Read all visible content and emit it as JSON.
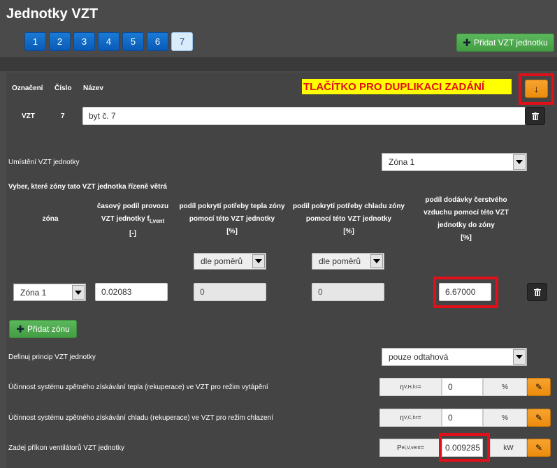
{
  "title": "Jednotky VZT",
  "pager": [
    "1",
    "2",
    "3",
    "4",
    "5",
    "6",
    "7"
  ],
  "add_unit_label": "Přidat VZT jednotku",
  "header": {
    "col_oznaceni": "Označení",
    "col_cislo": "Číslo",
    "col_nazev": "Název"
  },
  "annotation": "TLAČÍTKO PRO DUPLIKACI ZADÁNÍ",
  "unit": {
    "oznaceni": "VZT",
    "cislo": "7",
    "nazev": "byt č. 7"
  },
  "placement": {
    "label": "Umístění VZT jednotky",
    "value": "Zóna 1"
  },
  "zones_heading": "Vyber, které zóny tato VZT jednotka řízeně větrá",
  "table": {
    "col_zona": "zóna",
    "col_time_l1": "časový podíl provozu",
    "col_time_l2": "VZT jednotky f",
    "col_time_sub": "t,vent",
    "col_time_unit": "[-]",
    "col_heat": "podíl pokrytí potřeby tepla zóny pomocí této VZT jednotky",
    "col_heat_unit": "[%]",
    "col_cool": "podíl pokrytí potřeby chladu zóny pomocí této VZT jednotky",
    "col_cool_unit": "[%]",
    "col_supply": "podíl dodávky čerstvého vzduchu pomocí této VZT jednotky do zóny",
    "col_supply_unit": "[%]",
    "heat_mode": "dle poměrů",
    "cool_mode": "dle poměrů",
    "row": {
      "zone": "Zóna 1",
      "time": "0.02083",
      "heat": "0",
      "cool": "0",
      "supply": "6.67000"
    }
  },
  "add_zone_label": "Přidat zónu",
  "principle": {
    "label": "Definuj princip VZT jednotky",
    "value": "pouze odtahová"
  },
  "heat_recovery": {
    "label": "Účinnost systému zpětného získávání tepla (rekuperace) ve VZT pro režim vytápění",
    "symbol": "η",
    "sub": "V,H,hr",
    "eq": " =",
    "value": "0",
    "unit": "%"
  },
  "cool_recovery": {
    "label": "Účinnost systému zpětného získávání chladu (rekuperace) ve VZT pro režim chlazení",
    "symbol": "η",
    "sub": "V,C,hr",
    "eq": " =",
    "value": "0",
    "unit": "%"
  },
  "fan_power": {
    "label": "Zadej příkon ventilátorů VZT jednotky",
    "symbol": "P",
    "sub": "el,V,vent",
    "eq": "=",
    "value": "0.009285",
    "unit": "kW"
  },
  "colors": {
    "accent_blue": "#0a5bb8",
    "green": "#5cb85c",
    "orange": "#ec8c0c",
    "highlight_red": "#e0101a",
    "annotation_bg": "#ffff00"
  }
}
